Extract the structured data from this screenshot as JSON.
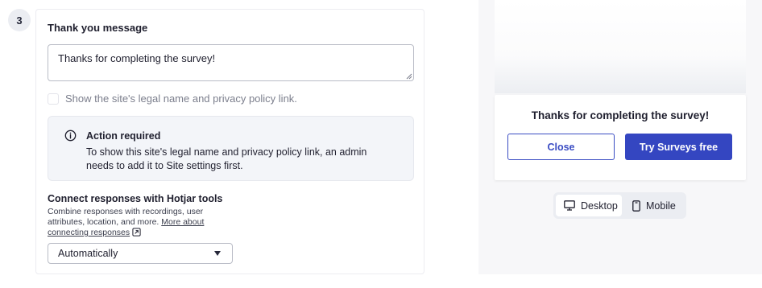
{
  "step": {
    "number": "3"
  },
  "thank_you": {
    "title": "Thank you message",
    "message_value": "Thanks for completing the survey!",
    "legal_checkbox_label": "Show the site's legal name and privacy policy link.",
    "legal_checkbox_checked": false
  },
  "alert": {
    "icon": "info-icon",
    "title": "Action required",
    "body": "To show this site's legal name and privacy policy link, an admin needs to add it to Site settings first."
  },
  "connect": {
    "title": "Connect responses with Hotjar tools",
    "description": "Combine responses with recordings, user attributes, location, and more.",
    "link_label": "More about connecting responses",
    "select_value": "Automatically"
  },
  "preview": {
    "message": "Thanks for completing the survey!",
    "close_label": "Close",
    "cta_label": "Try Surveys free",
    "device_toggle": {
      "desktop_label": "Desktop",
      "mobile_label": "Mobile",
      "selected": "Desktop"
    }
  },
  "colors": {
    "primary": "#3446c1",
    "alert_bg": "#f3f5f9",
    "preview_bg": "#f7f7f9"
  }
}
